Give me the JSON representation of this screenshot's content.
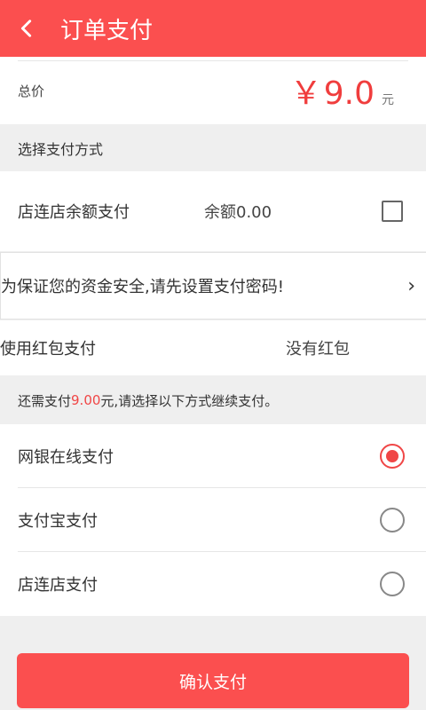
{
  "header": {
    "title": "订单支付",
    "back_icon": "chevron-left-icon"
  },
  "total": {
    "label": "总价",
    "currency": "￥",
    "amount": "9.0",
    "unit": "元"
  },
  "method_section": {
    "label": "选择支付方式"
  },
  "balance": {
    "label": "店连店余额支付",
    "value": "余额0.00",
    "checked": false
  },
  "password_prompt": {
    "text": "为保证您的资金安全,请先设置支付密码!",
    "chevron": "›"
  },
  "red_packet": {
    "label": "使用红包支付",
    "value": "没有红包"
  },
  "notice": {
    "prefix": "还需支付",
    "amount": "9.00",
    "suffix": "元,请选择以下方式继续支付。"
  },
  "pay_options": [
    {
      "label": "网银在线支付",
      "selected": true
    },
    {
      "label": "支付宝支付",
      "selected": false
    },
    {
      "label": "店连店支付",
      "selected": false
    }
  ],
  "confirm": {
    "label": "确认支付"
  },
  "colors": {
    "accent": "#fb4f4f",
    "price": "#f03d3d"
  }
}
